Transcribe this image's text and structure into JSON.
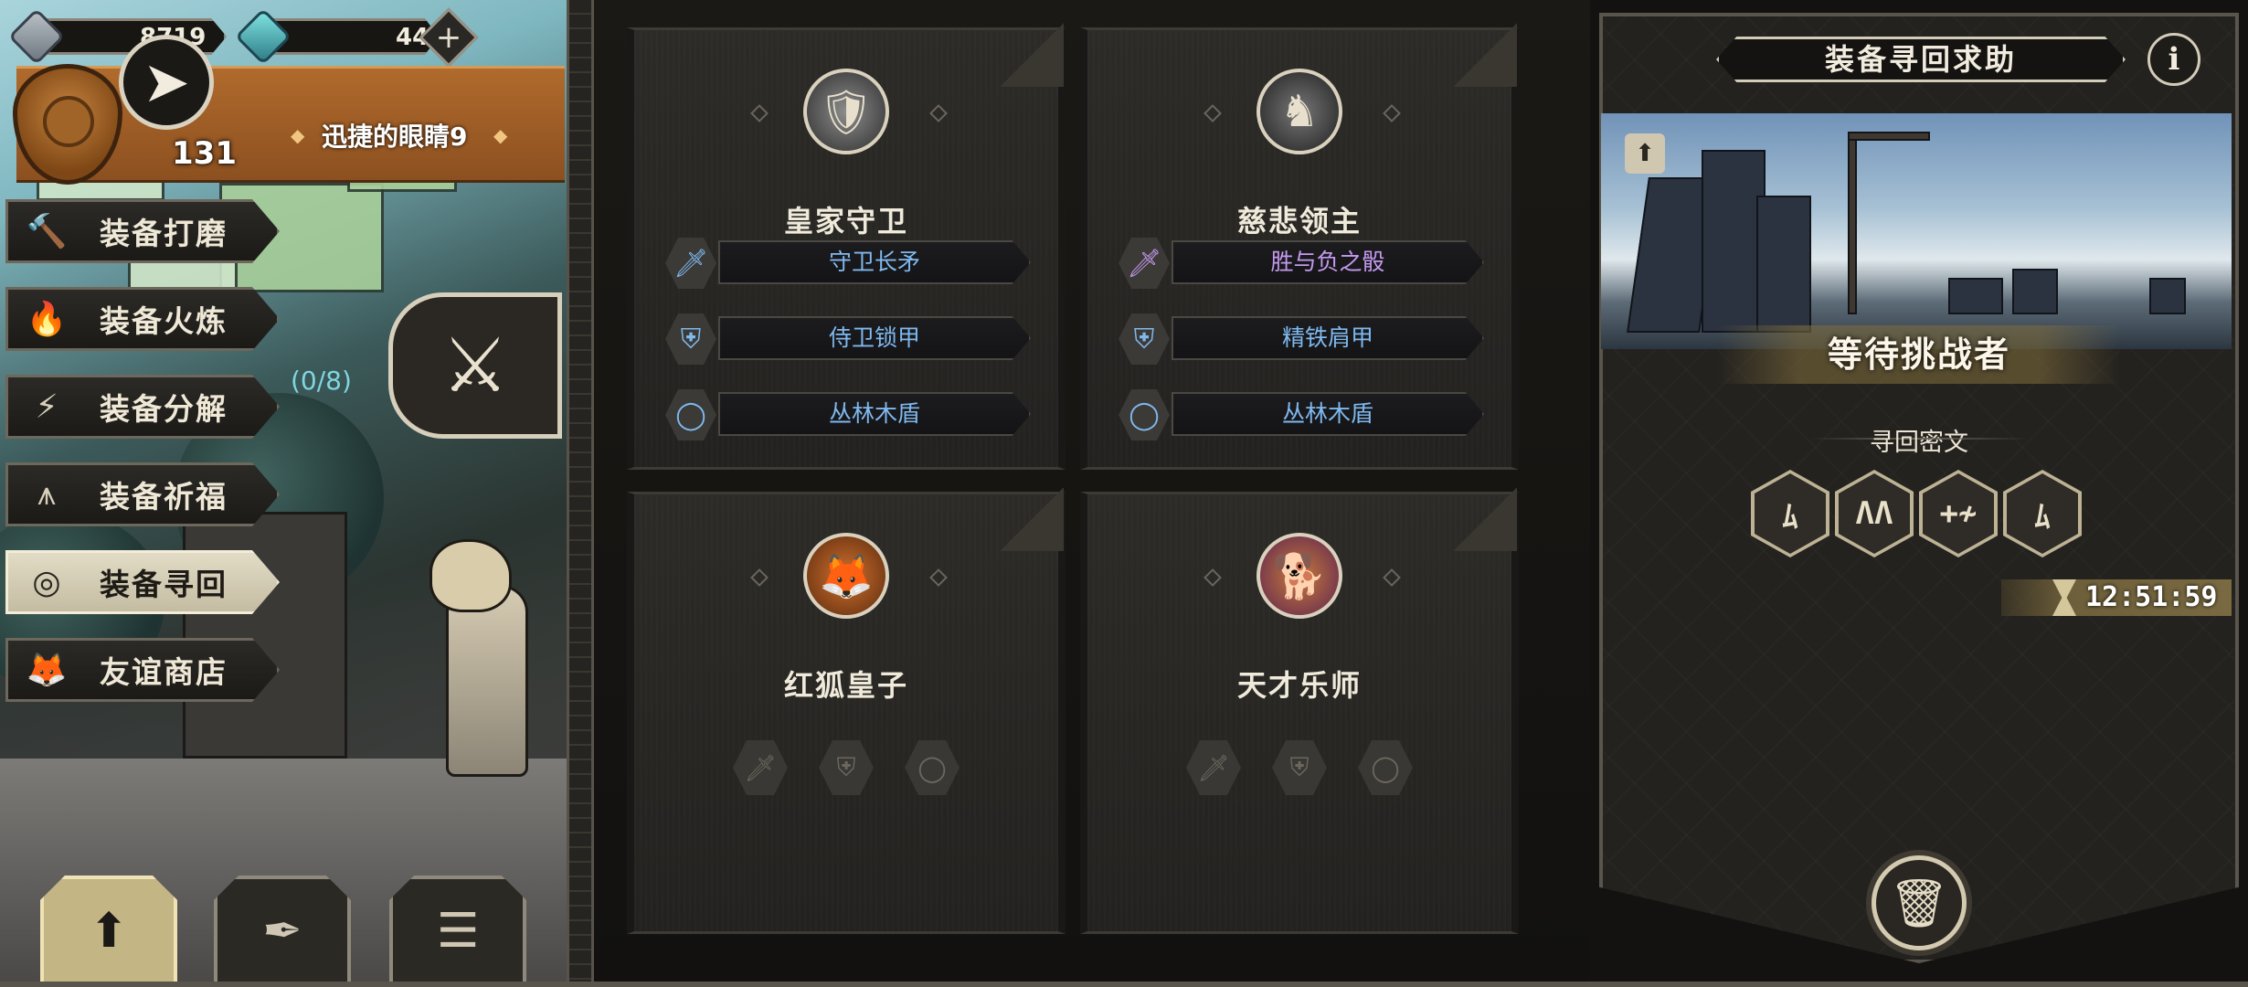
{
  "currency": {
    "silver_amount": "8719",
    "gem_amount": "44",
    "add_label": "+"
  },
  "player": {
    "level": "131",
    "achievement_name": "迅捷的眼睛9"
  },
  "side_menu": {
    "items": [
      {
        "label": "装备打磨",
        "icon": "hammer-icon",
        "active": false
      },
      {
        "label": "装备火炼",
        "icon": "flame-icon",
        "active": false
      },
      {
        "label": "装备分解",
        "icon": "decompose-icon",
        "active": false
      },
      {
        "label": "装备祈福",
        "icon": "blessing-icon",
        "active": false
      },
      {
        "label": "装备寻回",
        "icon": "retrieve-icon",
        "active": true
      },
      {
        "label": "友谊商店",
        "icon": "fox-icon",
        "active": false
      }
    ],
    "progress": "(0/8)"
  },
  "cards": [
    {
      "name": "皇家守卫",
      "portrait": "knight-portrait",
      "equipment": [
        {
          "icon": "sword-icon",
          "label": "守卫长矛",
          "quality": "blue"
        },
        {
          "icon": "armor-icon",
          "label": "侍卫锁甲",
          "quality": "blue"
        },
        {
          "icon": "ring-icon",
          "label": "丛林木盾",
          "quality": "blue"
        }
      ]
    },
    {
      "name": "慈悲领主",
      "portrait": "lord-portrait",
      "equipment": [
        {
          "icon": "sword-icon",
          "label": "胜与负之骰",
          "quality": "purple"
        },
        {
          "icon": "armor-icon",
          "label": "精铁肩甲",
          "quality": "blue"
        },
        {
          "icon": "ring-icon",
          "label": "丛林木盾",
          "quality": "blue"
        }
      ]
    },
    {
      "name": "红狐皇子",
      "portrait": "fox-prince-portrait",
      "equipment": []
    },
    {
      "name": "天才乐师",
      "portrait": "musician-portrait",
      "equipment": []
    }
  ],
  "help_panel": {
    "title": "装备寻回求助",
    "info_label": "i",
    "status": "等待挑战者",
    "cipher_label": "寻回密文",
    "runes": [
      "ﾑ",
      "ΛΛ",
      "+≁",
      "ﾑ"
    ],
    "timer": "12:51:59"
  },
  "colors": {
    "accent_gold": "#c4b585",
    "rare_blue": "#7fb9ef",
    "epic_purple": "#c49af0",
    "gem_teal": "#2f7d88"
  }
}
